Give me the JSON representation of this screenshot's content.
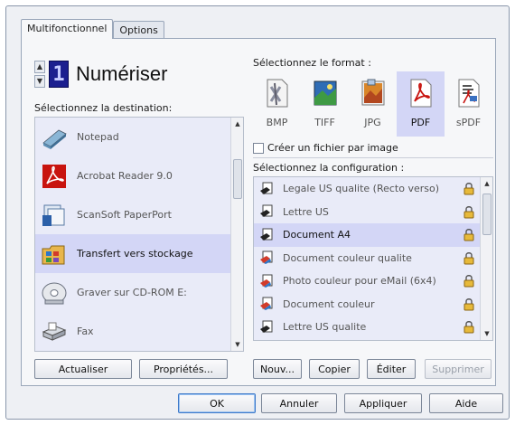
{
  "tabs": [
    {
      "label": "Multifonctionnel"
    },
    {
      "label": "Options"
    }
  ],
  "scan": {
    "counter": "1",
    "title": "Numériser"
  },
  "destination": {
    "label": "Sélectionnez la destination:",
    "items": [
      {
        "label": "Notepad",
        "icon": "notepad-icon"
      },
      {
        "label": "Acrobat Reader 9.0",
        "icon": "acrobat-icon"
      },
      {
        "label": "ScanSoft PaperPort",
        "icon": "paperport-icon"
      },
      {
        "label": "Transfert vers stockage",
        "icon": "storage-icon",
        "selected": true
      },
      {
        "label": "Graver sur CD-ROM  E:",
        "icon": "cd-icon"
      },
      {
        "label": "Fax",
        "icon": "fax-icon"
      }
    ]
  },
  "format": {
    "label": "Sélectionnez le format :",
    "items": [
      {
        "label": "BMP",
        "icon": "bmp-icon"
      },
      {
        "label": "TIFF",
        "icon": "tiff-icon"
      },
      {
        "label": "JPG",
        "icon": "jpg-icon"
      },
      {
        "label": "PDF",
        "icon": "pdf-icon",
        "selected": true
      },
      {
        "label": "sPDF",
        "icon": "spdf-icon"
      }
    ],
    "checkbox_label": "Créer un fichier par image"
  },
  "configuration": {
    "label": "Sélectionnez la configuration :",
    "items": [
      {
        "label": "Legale US qualite (Recto verso)"
      },
      {
        "label": "Lettre US"
      },
      {
        "label": "Document A4",
        "selected": true
      },
      {
        "label": "Document couleur qualite"
      },
      {
        "label": "Photo couleur pour eMail (6x4)"
      },
      {
        "label": "Document couleur"
      },
      {
        "label": "Lettre US qualite"
      }
    ]
  },
  "buttons": {
    "refresh": "Actualiser",
    "properties": "Propriétés...",
    "new": "Nouv...",
    "copy": "Copier",
    "edit": "Éditer",
    "delete": "Supprimer",
    "ok": "OK",
    "cancel": "Annuler",
    "apply": "Appliquer",
    "help": "Aide"
  },
  "colors": {
    "selection": "#d3d6f6",
    "list_background": "#e9ebf8",
    "lcd": "#1b1f8f"
  }
}
